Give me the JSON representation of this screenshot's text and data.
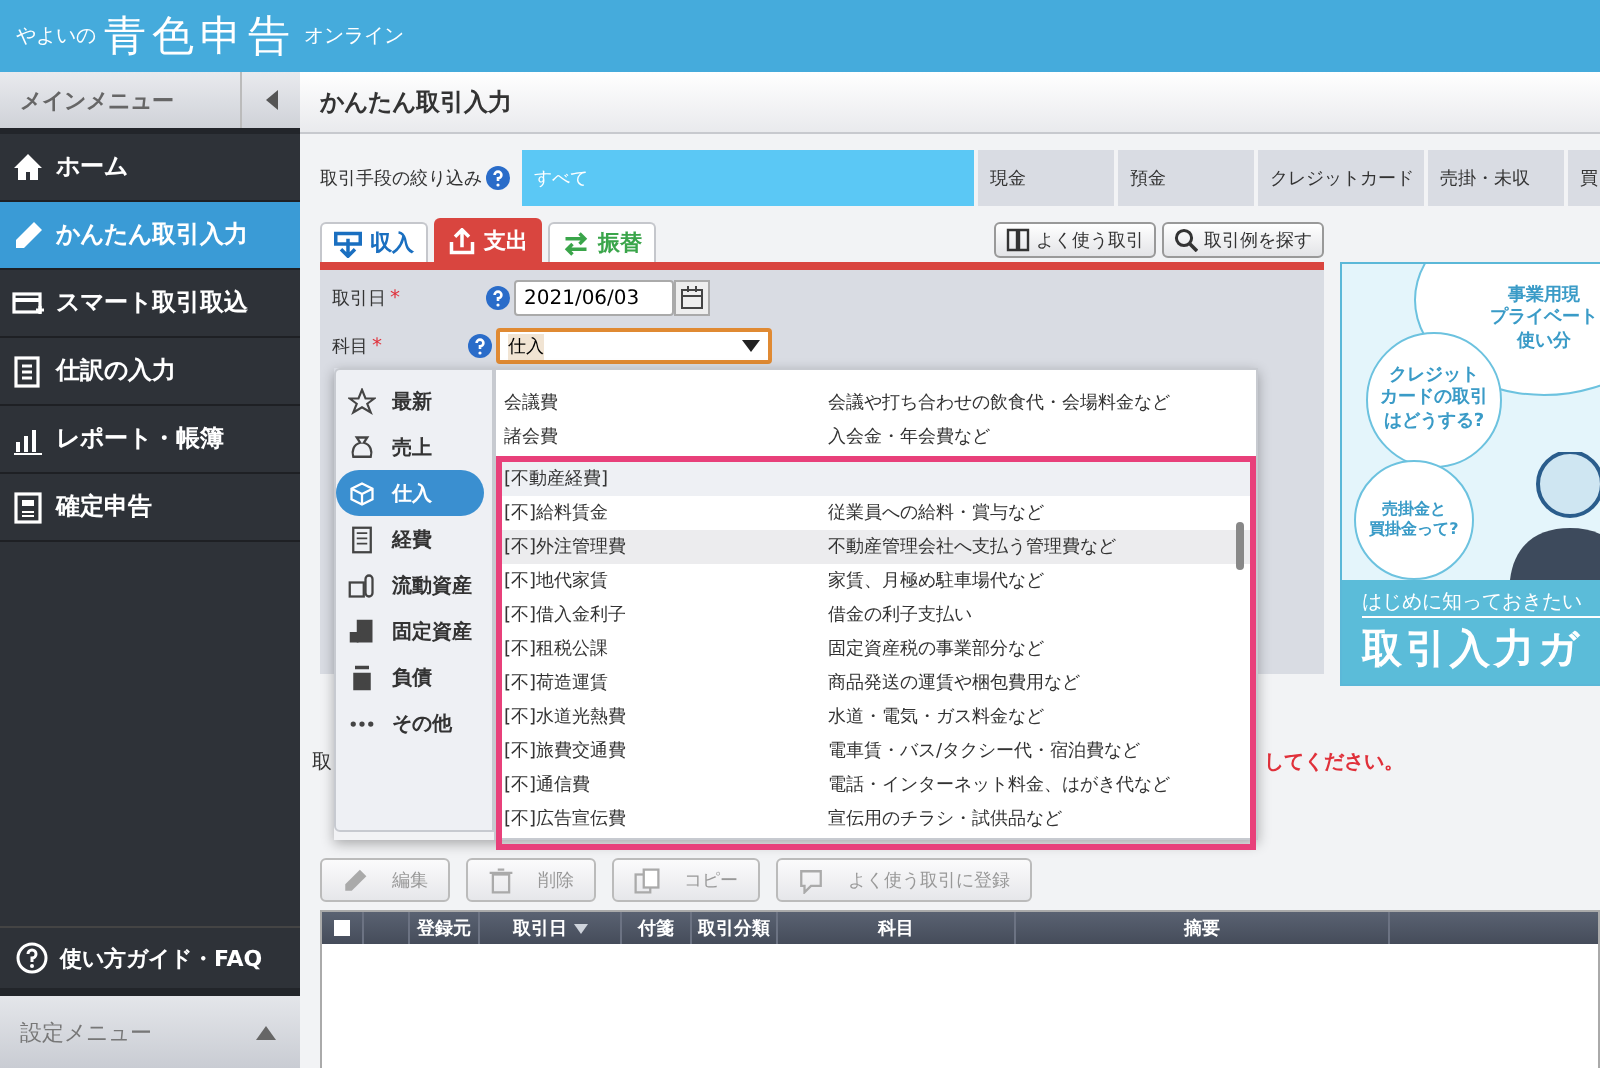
{
  "header": {
    "logo_prefix": "やよいの",
    "logo_main": "青色申告",
    "logo_suffix": "オンライン"
  },
  "sidebar": {
    "title": "メインメニュー",
    "items": [
      {
        "label": "ホーム",
        "selected": false
      },
      {
        "label": "かんたん取引入力",
        "selected": true
      },
      {
        "label": "スマート取引取込",
        "selected": false
      },
      {
        "label": "仕訳の入力",
        "selected": false
      },
      {
        "label": "レポート・帳簿",
        "selected": false
      },
      {
        "label": "確定申告",
        "selected": false
      }
    ],
    "guide_link": "使い方ガイド・FAQ",
    "settings_menu": "設定メニュー"
  },
  "page_title": "かんたん取引入力",
  "filter": {
    "label": "取引手段の絞り込み",
    "options": [
      {
        "label": "すべて",
        "selected": true
      },
      {
        "label": "現金",
        "selected": false
      },
      {
        "label": "預金",
        "selected": false
      },
      {
        "label": "クレジットカード",
        "selected": false
      },
      {
        "label": "売掛・未収",
        "selected": false
      },
      {
        "label": "買",
        "selected": false
      }
    ]
  },
  "entry_tabs": [
    {
      "label": "収入",
      "selected": false,
      "color": "#1a6fc0"
    },
    {
      "label": "支出",
      "selected": true,
      "color": "#d9453f"
    },
    {
      "label": "振替",
      "selected": false,
      "color": "#3aa54a"
    }
  ],
  "tool_buttons": [
    "よく使う取引",
    "取引例を探す"
  ],
  "form": {
    "fields": [
      {
        "kind": "date",
        "label": "取引日",
        "required_mark": "*",
        "value": "2021/06/03"
      },
      {
        "kind": "select",
        "label": "科目",
        "required_mark": "*",
        "value": "仕入"
      }
    ]
  },
  "dropdown": {
    "categories": [
      {
        "label": "最新",
        "selected": false
      },
      {
        "label": "売上",
        "selected": false
      },
      {
        "label": "仕入",
        "selected": true
      },
      {
        "label": "経費",
        "selected": false
      },
      {
        "label": "流動資産",
        "selected": false
      },
      {
        "label": "固定資産",
        "selected": false
      },
      {
        "label": "負債",
        "selected": false
      },
      {
        "label": "その他",
        "selected": false
      }
    ],
    "rows": [
      {
        "kind": "item",
        "name": "会議費",
        "description": "会議や打ち合わせの飲食代・会場料金など",
        "hovered": false
      },
      {
        "kind": "item",
        "name": "諸会費",
        "description": "入会金・年会費など",
        "hovered": false
      }
    ],
    "highlight_box": {
      "rows": [
        {
          "kind": "group",
          "name": "[不動産経費]"
        },
        {
          "kind": "item",
          "name": "[不]給料賃金",
          "description": "従業員への給料・賞与など",
          "hovered": false
        },
        {
          "kind": "item",
          "name": "[不]外注管理費",
          "description": "不動産管理会社へ支払う管理費など",
          "hovered": true
        },
        {
          "kind": "item",
          "name": "[不]地代家賃",
          "description": "家賃、月極め駐車場代など",
          "hovered": false
        },
        {
          "kind": "item",
          "name": "[不]借入金利子",
          "description": "借金の利子支払い",
          "hovered": false
        },
        {
          "kind": "item",
          "name": "[不]租税公課",
          "description": "固定資産税の事業部分など",
          "hovered": false
        },
        {
          "kind": "item",
          "name": "[不]荷造運賃",
          "description": "商品発送の運賃や梱包費用など",
          "hovered": false
        },
        {
          "kind": "item",
          "name": "[不]水道光熱費",
          "description": "水道・電気・ガス料金など",
          "hovered": false
        },
        {
          "kind": "item",
          "name": "[不]旅費交通費",
          "description": "電車賃・バス/タクシー代・宿泊費など",
          "hovered": false
        },
        {
          "kind": "item",
          "name": "[不]通信費",
          "description": "電話・インターネット料金、はがき代など",
          "hovered": false
        },
        {
          "kind": "item",
          "name": "[不]広告宣伝費",
          "description": "宣伝用のチラシ・試供品など",
          "hovered": false
        }
      ]
    }
  },
  "banner": {
    "bubbles": [
      {
        "lines": [
          "事業用現",
          "プライベート",
          "使い分"
        ]
      },
      {
        "lines": [
          "クレジット",
          "カードの取引",
          "はどうする?"
        ]
      },
      {
        "lines": [
          "売掛金と",
          "買掛金って?"
        ]
      }
    ],
    "subtitle": "はじめに知っておきたい",
    "title": "取引入力ガ"
  },
  "list_label": "取",
  "notice": "してください。",
  "actions": [
    {
      "label": "編集",
      "disabled": true
    },
    {
      "label": "削除",
      "disabled": true
    },
    {
      "label": "コピー",
      "disabled": true
    },
    {
      "label": "よく使う取引に登録",
      "disabled": true
    }
  ],
  "table": {
    "select_all_checked": false,
    "columns": [
      {
        "label": "登録元",
        "sorted": false
      },
      {
        "label": "取引日",
        "sorted": true
      },
      {
        "label": "付箋",
        "sorted": false
      },
      {
        "label": "取引分類",
        "sorted": false
      },
      {
        "label": "科目",
        "sorted": false
      },
      {
        "label": "摘要",
        "sorted": false
      }
    ]
  }
}
